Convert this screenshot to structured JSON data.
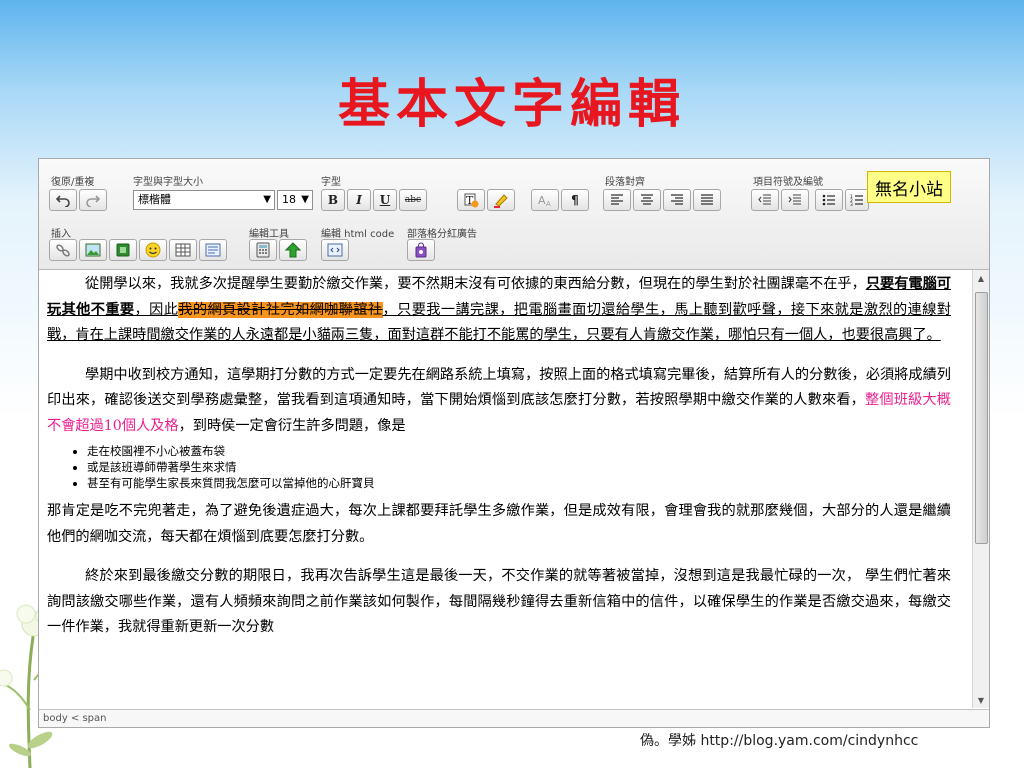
{
  "slide_title": "基本文字編輯",
  "badge": "無名小站",
  "footer": "偽。學姊 http://blog.yam.com/cindynhcc",
  "toolbar": {
    "groups": {
      "undo_redo": "復原/重複",
      "font_size": "字型與字型大小",
      "font_style": "字型",
      "alignment": "段落對齊",
      "lists": "項目符號及編號",
      "insert": "插入",
      "edit_tools": "編輯工具",
      "edit_html": "編輯 html code",
      "blog_ads": "部落格分紅廣告"
    },
    "font_name": "標楷體",
    "font_size": "18",
    "bold": "B",
    "italic": "I",
    "underline": "U",
    "strike": "abc",
    "paragraph": "¶"
  },
  "content": {
    "p1": {
      "a": "從開學以來，我就多次提醒學生要勤於繳交作業，要不然期末沒有可依據的東西給分數，但現在的學生對於社團課毫不在乎，",
      "b": "只要有電腦可玩其他不重要",
      "c": "，因此",
      "d": "我的網頁設計社完如網咖聯誼社",
      "e": "，只要我一講完課，把電腦畫面切還給學生，馬上聽到歡呼聲，接下來就是激烈的連線對戰，肯在上課時間繳交作業的人永遠都是小貓兩三隻，面對這群不能打不能罵的學生，只要有人肯繳交作業，哪怕只有一個人，也要很高興了。"
    },
    "p2": {
      "a": "學期中收到校方通知，這學期打分數的方式一定要先在網路系統上填寫，按照上面的格式填寫完畢後，結算所有人的分數後，必須將成績列印出來，確認後送交到學務處彙整，當我看到這項通知時，當下開始煩惱到底該怎麼打分數，若按照學期中繳交作業的人數來看，",
      "b": "整個班級大概不會超過10個人及格",
      "c": "，到時侯一定會衍生許多問題，像是"
    },
    "bullets": [
      "走在校園裡不小心被蓋布袋",
      "或是該班導師帶著學生來求情",
      "甚至有可能學生家長來質問我怎麼可以當掉他的心肝寶貝"
    ],
    "p3": "那肯定是吃不完兜著走，為了避免後遺症過大，每次上課都要拜託學生多繳作業，但是成效有限，會理會我的就那麼幾個，大部分的人還是繼續他們的網咖交流，每天都在煩惱到底要怎麼打分數。",
    "p4": "終於來到最後繳交分數的期限日，我再次告訴學生這是最後一天，不交作業的就等著被當掉，沒想到這是我最忙碌的一次， 學生們忙著來詢問該繳交哪些作業，還有人頻頻來詢問之前作業該如何製作，每間隔幾秒鐘得去重新信箱中的信件，以確保學生的作業是否繳交過來，每繳交一件作業，我就得重新更新一次分數"
  },
  "statusbar": "body < span",
  "colors": {
    "title": "#e8161e",
    "highlight": "#f7941d",
    "pink": "#ec1f8f",
    "badge_bg": "#ffff88"
  }
}
